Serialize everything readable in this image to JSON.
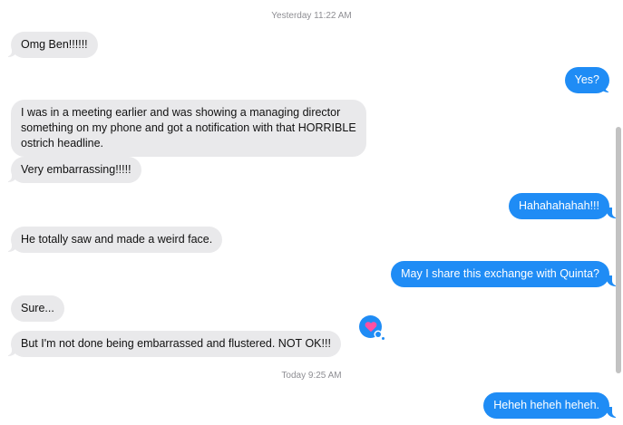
{
  "thread": {
    "timestamps": [
      "Yesterday 11:22 AM",
      "Today 9:25 AM"
    ],
    "messages": [
      {
        "from": "them",
        "text": "Omg Ben!!!!!!"
      },
      {
        "from": "me",
        "text": "Yes?"
      },
      {
        "from": "them",
        "text": "I was in a meeting earlier and was showing a managing director\nsomething on my phone and got a notification with that HORRIBLE\nostrich headline."
      },
      {
        "from": "them",
        "text": "Very embarrassing!!!!!"
      },
      {
        "from": "me",
        "text": "Hahahahahah!!!"
      },
      {
        "from": "them",
        "text": "He totally saw and made a weird face."
      },
      {
        "from": "me",
        "text": "May I share this exchange with Quinta?"
      },
      {
        "from": "them",
        "text": "Sure..."
      },
      {
        "from": "them",
        "text": "But I'm not done being embarrassed and flustered. NOT OK!!!"
      },
      {
        "from": "me",
        "text": "Heheh heheh heheh."
      }
    ],
    "tapback": {
      "icon": "heart-icon",
      "on_message": 8,
      "color": "#1f8cf5",
      "heart_color": "#ff4fa3"
    }
  },
  "colors": {
    "incoming_bubble": "#e9e9eb",
    "outgoing_bubble": "#1f8cf5",
    "timestamp": "#8e8e93"
  }
}
